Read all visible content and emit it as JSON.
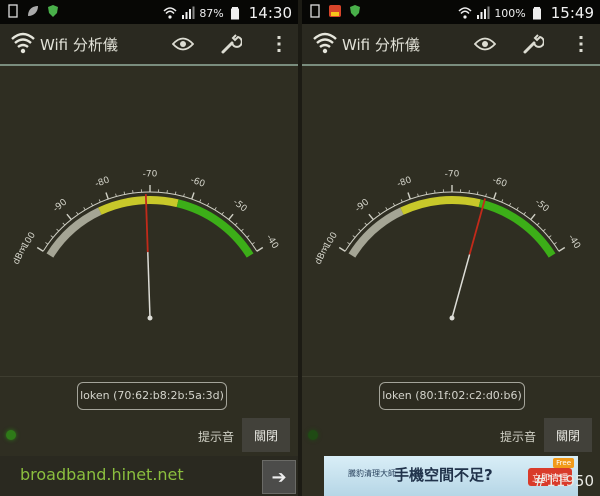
{
  "colors": {
    "background": "#2f2e22",
    "status_bar": "#070705",
    "arc_gray": "#a5a595",
    "arc_yellow": "#c8c82a",
    "arc_green": "#3cae18",
    "needle_red": "#c22a1a",
    "needle_white": "#dcdcd6",
    "ad_text_green": "#8bbf3e"
  },
  "scale": {
    "unit": "dBm",
    "ticks": [
      "-100",
      "-90",
      "-80",
      "-70",
      "-60",
      "-50",
      "-40"
    ]
  },
  "panels": [
    {
      "status_bar": {
        "left_icons": [
          "sim-card-icon",
          "leaf-icon",
          "shield-icon"
        ],
        "right_icons": [
          "wifi-signal-icon",
          "cell-signal-icon",
          "battery-icon"
        ],
        "battery_percent": "87%",
        "time": "14:30"
      },
      "app_title": "Wifi 分析儀",
      "toolbar_icons": [
        "eye-icon",
        "wrench-icon",
        "overflow-menu-icon"
      ],
      "signal_dbm": -71,
      "ssid_label": "loken (70:62:b8:2b:5a:3d)",
      "sound_label": "提示音",
      "toggle_label": "關閉",
      "led_color": "#2e7a18",
      "bottom_ad": {
        "text": "broadband.hinet.net",
        "icon": "arrow-right-icon"
      }
    },
    {
      "status_bar": {
        "left_icons": [
          "sim-card-icon",
          "free-badge-icon",
          "shield-icon"
        ],
        "right_icons": [
          "wifi-signal-icon",
          "cell-signal-icon",
          "battery-icon"
        ],
        "battery_percent": "100%",
        "time": "15:49"
      },
      "app_title": "Wifi 分析儀",
      "toolbar_icons": [
        "eye-icon",
        "wrench-icon",
        "overflow-menu-icon"
      ],
      "signal_dbm": -62,
      "ssid_label": "loken (80:1f:02:c2:d0:b6)",
      "sound_label": "提示音",
      "toggle_label": "關閉",
      "led_color": "#1f4a14",
      "bottom_ad": {
        "text": "手機空間不足?",
        "button": "立即清理",
        "badge": "Free",
        "small": "騰豹清理大師"
      }
    }
  ],
  "watermark": "#11950"
}
